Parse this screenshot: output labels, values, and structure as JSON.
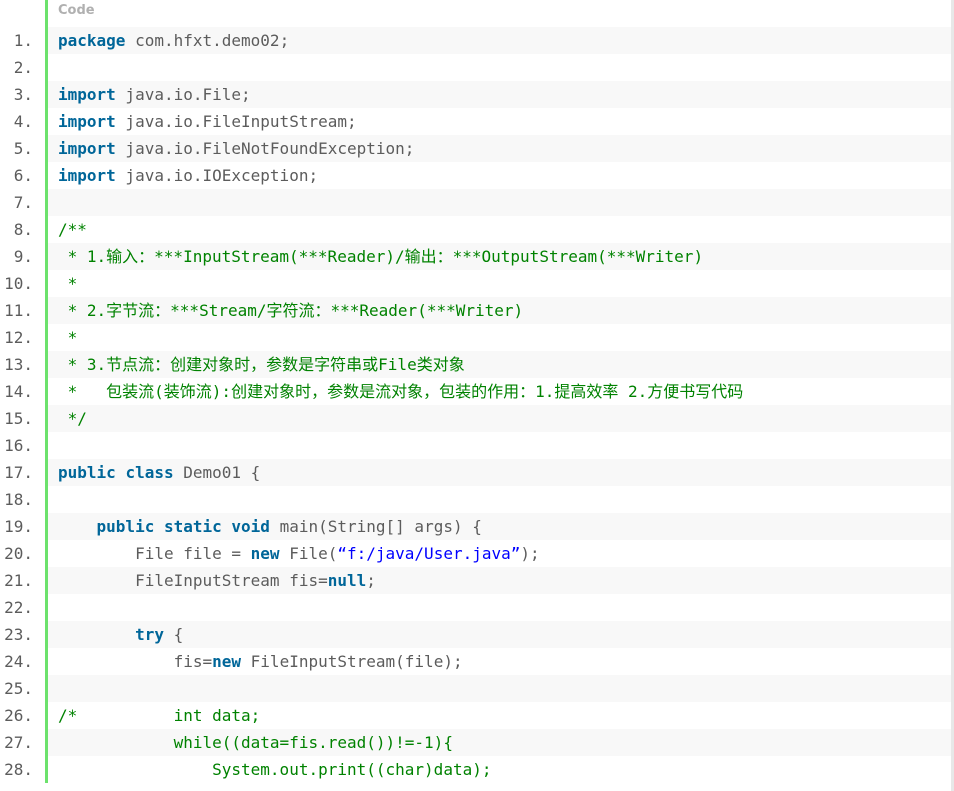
{
  "header": {
    "title": "Code"
  },
  "lines": [
    {
      "n": "1.",
      "tokens": [
        [
          "kw",
          "package"
        ],
        [
          "id",
          " com.hfxt.demo02;"
        ]
      ]
    },
    {
      "n": "2.",
      "tokens": []
    },
    {
      "n": "3.",
      "tokens": [
        [
          "kw",
          "import"
        ],
        [
          "id",
          " java.io.File;"
        ]
      ]
    },
    {
      "n": "4.",
      "tokens": [
        [
          "kw",
          "import"
        ],
        [
          "id",
          " java.io.FileInputStream;"
        ]
      ]
    },
    {
      "n": "5.",
      "tokens": [
        [
          "kw",
          "import"
        ],
        [
          "id",
          " java.io.FileNotFoundException;"
        ]
      ]
    },
    {
      "n": "6.",
      "tokens": [
        [
          "kw",
          "import"
        ],
        [
          "id",
          " java.io.IOException;"
        ]
      ]
    },
    {
      "n": "7.",
      "tokens": []
    },
    {
      "n": "8.",
      "tokens": [
        [
          "cm",
          "/**"
        ]
      ]
    },
    {
      "n": "9.",
      "tokens": [
        [
          "cm",
          " * 1.输入：***InputStream(***Reader)/输出：***OutputStream(***Writer)"
        ]
      ]
    },
    {
      "n": "10.",
      "tokens": [
        [
          "cm",
          " *"
        ]
      ]
    },
    {
      "n": "11.",
      "tokens": [
        [
          "cm",
          " * 2.字节流：***Stream/字符流：***Reader(***Writer)"
        ]
      ]
    },
    {
      "n": "12.",
      "tokens": [
        [
          "cm",
          " *"
        ]
      ]
    },
    {
      "n": "13.",
      "tokens": [
        [
          "cm",
          " * 3.节点流：创建对象时，参数是字符串或File类对象"
        ]
      ]
    },
    {
      "n": "14.",
      "tokens": [
        [
          "cm",
          " *   包装流(装饰流):创建对象时，参数是流对象，包装的作用：1.提高效率 2.方便书写代码"
        ]
      ]
    },
    {
      "n": "15.",
      "tokens": [
        [
          "cm",
          " */"
        ]
      ]
    },
    {
      "n": "16.",
      "tokens": []
    },
    {
      "n": "17.",
      "tokens": [
        [
          "kw",
          "public"
        ],
        [
          "id",
          " "
        ],
        [
          "kw",
          "class"
        ],
        [
          "id",
          " Demo01 {"
        ]
      ]
    },
    {
      "n": "18.",
      "tokens": []
    },
    {
      "n": "19.",
      "tokens": [
        [
          "id",
          "    "
        ],
        [
          "kw",
          "public"
        ],
        [
          "id",
          " "
        ],
        [
          "kw",
          "static"
        ],
        [
          "id",
          " "
        ],
        [
          "kw",
          "void"
        ],
        [
          "id",
          " main(String[] args) {"
        ]
      ]
    },
    {
      "n": "20.",
      "tokens": [
        [
          "id",
          "        File file = "
        ],
        [
          "kw",
          "new"
        ],
        [
          "id",
          " File("
        ],
        [
          "str",
          "“f:/java/User.java”"
        ],
        [
          "id",
          ");"
        ]
      ]
    },
    {
      "n": "21.",
      "tokens": [
        [
          "id",
          "        FileInputStream fis="
        ],
        [
          "kw",
          "null"
        ],
        [
          "id",
          ";"
        ]
      ]
    },
    {
      "n": "22.",
      "tokens": []
    },
    {
      "n": "23.",
      "tokens": [
        [
          "id",
          "        "
        ],
        [
          "kw",
          "try"
        ],
        [
          "id",
          " {"
        ]
      ]
    },
    {
      "n": "24.",
      "tokens": [
        [
          "id",
          "            fis="
        ],
        [
          "kw",
          "new"
        ],
        [
          "id",
          " FileInputStream(file);"
        ]
      ]
    },
    {
      "n": "25.",
      "tokens": []
    },
    {
      "n": "26.",
      "tokens": [
        [
          "cm",
          "/*          int data;"
        ]
      ]
    },
    {
      "n": "27.",
      "tokens": [
        [
          "cm",
          "            while((data=fis.read())!=-1){"
        ]
      ]
    },
    {
      "n": "28.",
      "tokens": [
        [
          "cm",
          "                System.out.print((char)data);"
        ]
      ]
    }
  ],
  "colors": {
    "keyword": "#006699",
    "comment": "#008200",
    "string": "#0000ff",
    "gutter_border": "#6ce26c",
    "alt_row": "#f8f8f8"
  }
}
